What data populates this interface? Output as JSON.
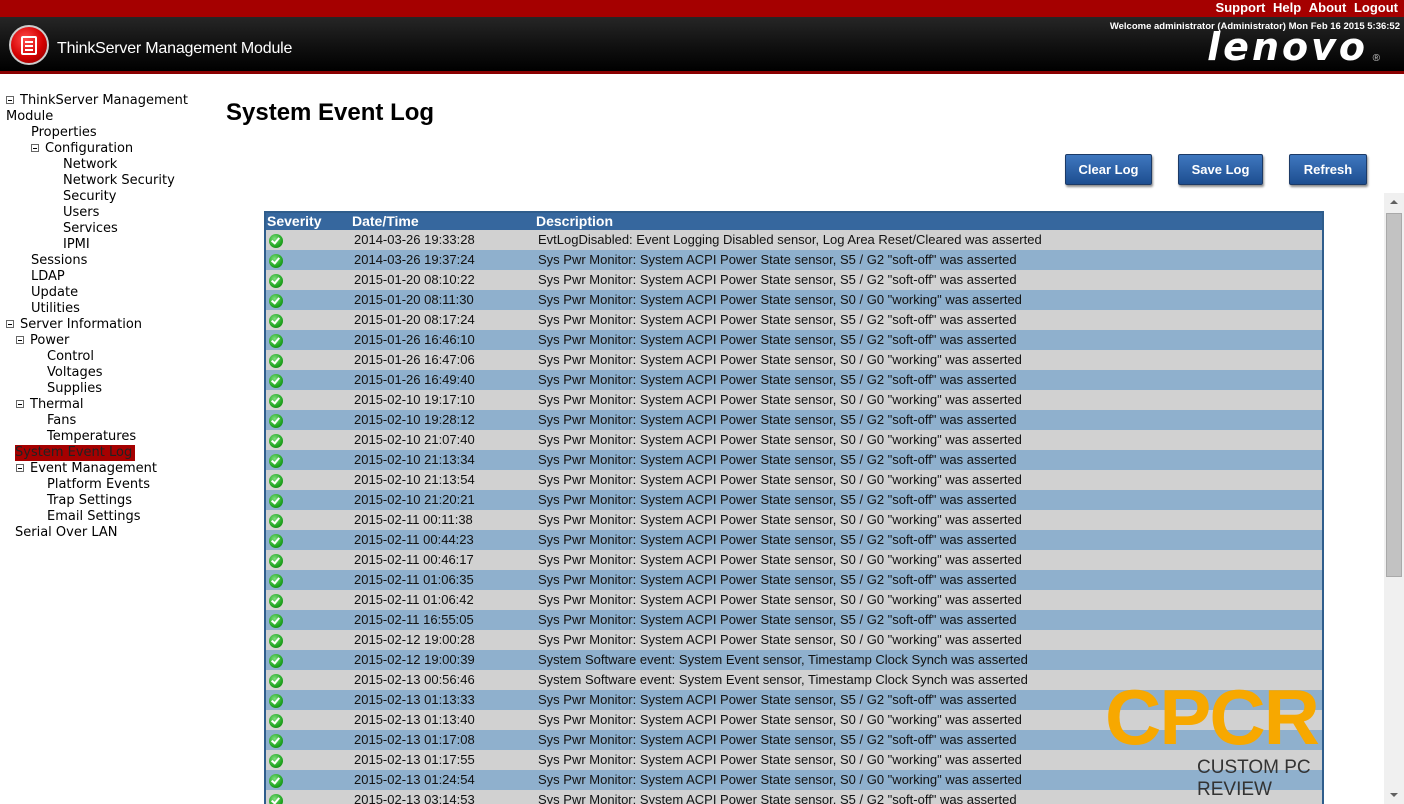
{
  "topbar": {
    "links": [
      "Support",
      "Help",
      "About",
      "Logout"
    ]
  },
  "header": {
    "app_title": "ThinkServer Management Module",
    "welcome": "Welcome administrator (Administrator) Mon Feb 16 2015 5:36:52",
    "brand": "lenovo",
    "reg": "®"
  },
  "sidebar": {
    "items": [
      {
        "label": "ThinkServer Management",
        "continuation": "Module"
      },
      {
        "label": "Properties"
      },
      {
        "label": "Configuration"
      },
      {
        "label": "Network"
      },
      {
        "label": "Network Security"
      },
      {
        "label": "Security"
      },
      {
        "label": "Users"
      },
      {
        "label": "Services"
      },
      {
        "label": "IPMI"
      },
      {
        "label": "Sessions"
      },
      {
        "label": "LDAP"
      },
      {
        "label": "Update"
      },
      {
        "label": "Utilities"
      },
      {
        "label": "Server Information"
      },
      {
        "label": "Power"
      },
      {
        "label": "Control"
      },
      {
        "label": "Voltages"
      },
      {
        "label": "Supplies"
      },
      {
        "label": "Thermal"
      },
      {
        "label": "Fans"
      },
      {
        "label": "Temperatures"
      },
      {
        "label": "System Event Log"
      },
      {
        "label": "Event Management"
      },
      {
        "label": "Platform Events"
      },
      {
        "label": "Trap Settings"
      },
      {
        "label": "Email Settings"
      },
      {
        "label": "Serial Over LAN"
      }
    ]
  },
  "main": {
    "title": "System Event Log",
    "buttons": {
      "clear": "Clear Log",
      "save": "Save Log",
      "refresh": "Refresh"
    },
    "columns": [
      "Severity",
      "Date/Time",
      "Description"
    ],
    "rows": [
      {
        "dt": "2014-03-26 19:33:28",
        "desc": "EvtLogDisabled: Event Logging Disabled sensor, Log Area Reset/Cleared was asserted"
      },
      {
        "dt": "2014-03-26 19:37:24",
        "desc": "Sys Pwr Monitor: System ACPI Power State sensor, S5 / G2 \"soft-off\" was asserted"
      },
      {
        "dt": "2015-01-20 08:10:22",
        "desc": "Sys Pwr Monitor: System ACPI Power State sensor, S5 / G2 \"soft-off\" was asserted"
      },
      {
        "dt": "2015-01-20 08:11:30",
        "desc": "Sys Pwr Monitor: System ACPI Power State sensor, S0 / G0 \"working\" was asserted"
      },
      {
        "dt": "2015-01-20 08:17:24",
        "desc": "Sys Pwr Monitor: System ACPI Power State sensor, S5 / G2 \"soft-off\" was asserted"
      },
      {
        "dt": "2015-01-26 16:46:10",
        "desc": "Sys Pwr Monitor: System ACPI Power State sensor, S5 / G2 \"soft-off\" was asserted"
      },
      {
        "dt": "2015-01-26 16:47:06",
        "desc": "Sys Pwr Monitor: System ACPI Power State sensor, S0 / G0 \"working\" was asserted"
      },
      {
        "dt": "2015-01-26 16:49:40",
        "desc": "Sys Pwr Monitor: System ACPI Power State sensor, S5 / G2 \"soft-off\" was asserted"
      },
      {
        "dt": "2015-02-10 19:17:10",
        "desc": "Sys Pwr Monitor: System ACPI Power State sensor, S0 / G0 \"working\" was asserted"
      },
      {
        "dt": "2015-02-10 19:28:12",
        "desc": "Sys Pwr Monitor: System ACPI Power State sensor, S5 / G2 \"soft-off\" was asserted"
      },
      {
        "dt": "2015-02-10 21:07:40",
        "desc": "Sys Pwr Monitor: System ACPI Power State sensor, S0 / G0 \"working\" was asserted"
      },
      {
        "dt": "2015-02-10 21:13:34",
        "desc": "Sys Pwr Monitor: System ACPI Power State sensor, S5 / G2 \"soft-off\" was asserted"
      },
      {
        "dt": "2015-02-10 21:13:54",
        "desc": "Sys Pwr Monitor: System ACPI Power State sensor, S0 / G0 \"working\" was asserted"
      },
      {
        "dt": "2015-02-10 21:20:21",
        "desc": "Sys Pwr Monitor: System ACPI Power State sensor, S5 / G2 \"soft-off\" was asserted"
      },
      {
        "dt": "2015-02-11 00:11:38",
        "desc": "Sys Pwr Monitor: System ACPI Power State sensor, S0 / G0 \"working\" was asserted"
      },
      {
        "dt": "2015-02-11 00:44:23",
        "desc": "Sys Pwr Monitor: System ACPI Power State sensor, S5 / G2 \"soft-off\" was asserted"
      },
      {
        "dt": "2015-02-11 00:46:17",
        "desc": "Sys Pwr Monitor: System ACPI Power State sensor, S0 / G0 \"working\" was asserted"
      },
      {
        "dt": "2015-02-11 01:06:35",
        "desc": "Sys Pwr Monitor: System ACPI Power State sensor, S5 / G2 \"soft-off\" was asserted"
      },
      {
        "dt": "2015-02-11 01:06:42",
        "desc": "Sys Pwr Monitor: System ACPI Power State sensor, S0 / G0 \"working\" was asserted"
      },
      {
        "dt": "2015-02-11 16:55:05",
        "desc": "Sys Pwr Monitor: System ACPI Power State sensor, S5 / G2 \"soft-off\" was asserted"
      },
      {
        "dt": "2015-02-12 19:00:28",
        "desc": "Sys Pwr Monitor: System ACPI Power State sensor, S0 / G0 \"working\" was asserted"
      },
      {
        "dt": "2015-02-12 19:00:39",
        "desc": "System Software event: System Event sensor, Timestamp Clock Synch was asserted"
      },
      {
        "dt": "2015-02-13 00:56:46",
        "desc": "System Software event: System Event sensor, Timestamp Clock Synch was asserted"
      },
      {
        "dt": "2015-02-13 01:13:33",
        "desc": "Sys Pwr Monitor: System ACPI Power State sensor, S5 / G2 \"soft-off\" was asserted"
      },
      {
        "dt": "2015-02-13 01:13:40",
        "desc": "Sys Pwr Monitor: System ACPI Power State sensor, S0 / G0 \"working\" was asserted"
      },
      {
        "dt": "2015-02-13 01:17:08",
        "desc": "Sys Pwr Monitor: System ACPI Power State sensor, S5 / G2 \"soft-off\" was asserted"
      },
      {
        "dt": "2015-02-13 01:17:55",
        "desc": "Sys Pwr Monitor: System ACPI Power State sensor, S0 / G0 \"working\" was asserted"
      },
      {
        "dt": "2015-02-13 01:24:54",
        "desc": "Sys Pwr Monitor: System ACPI Power State sensor, S0 / G0 \"working\" was asserted"
      },
      {
        "dt": "2015-02-13 03:14:53",
        "desc": "Sys Pwr Monitor: System ACPI Power State sensor, S5 / G2 \"soft-off\" was asserted"
      }
    ]
  },
  "watermark": {
    "logo_text": "CPCR",
    "caption": "CUSTOM PC REVIEW"
  },
  "colors": {
    "topbar": "#a50000",
    "header_bottom": "#8a0000",
    "button": "#1d4e90",
    "table_header": "#36679e",
    "row_gray": "#d1d1d1",
    "row_blue": "#8fb0cd",
    "ok_green": "#21a521",
    "watermark_orange": "#f7a800"
  }
}
